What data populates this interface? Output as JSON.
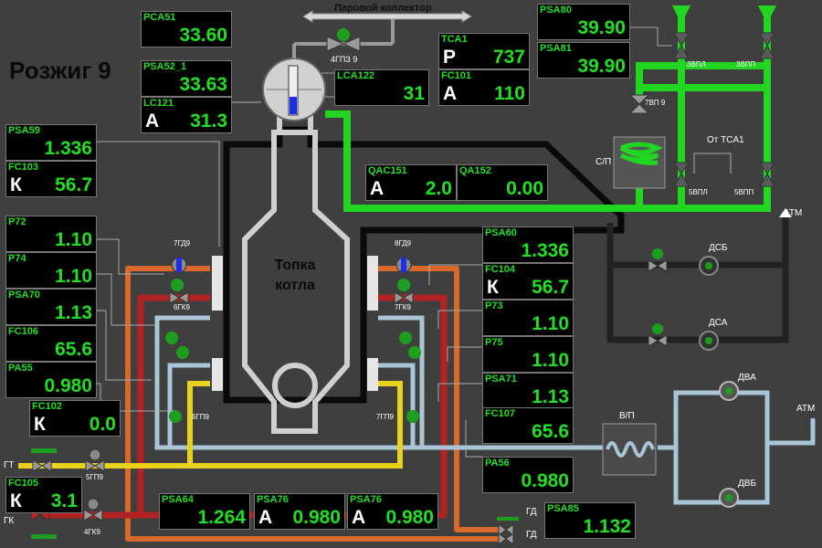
{
  "title": "Розжиг 9",
  "furnace_label": "Топка котла",
  "labels": {
    "steam_header": "Паровой коллектор",
    "from_tca1": "От TCA1",
    "atm1": "АТМ",
    "atm2": "АТМ",
    "dsb": "ДСБ",
    "dsa": "ДСА",
    "dva": "ДВА",
    "dvb": "ДВБ",
    "vp": "В/П",
    "sp": "С/П",
    "gt": "ГТ",
    "gk": "ГК",
    "gd1": "ГД",
    "gd2": "ГД"
  },
  "valves": {
    "v4gpz9": "4ГПЗ 9",
    "v3vpl": "3ВПЛ",
    "v3vpp": "3ВПП",
    "v7vp9": "7ВП 9",
    "v5vpl": "5ВПЛ",
    "v5vpp": "5ВПП",
    "v7gd9": "7ГД9",
    "v6gk9": "6ГК9",
    "v6gp9": "6ГП9",
    "v8gd9": "8ГД9",
    "v7gk9": "7ГК9",
    "v7gp9": "7ГП9",
    "v5gp9": "5ГП9",
    "v4gk9": "4ГК9"
  },
  "colors": {
    "steam_pipe": "#21d621",
    "gas_pipe": "#e8d21c",
    "fuel_pipe": "#b22222",
    "air_pipe": "#a9c6d8",
    "flue_pipe": "#222222",
    "value_text": "#21e021",
    "valve_indicator": "#1e9e1e"
  },
  "params": [
    {
      "tag": "PCA51",
      "value": "33.60"
    },
    {
      "tag": "PSA52_1",
      "value": "33.63"
    },
    {
      "tag": "LC121",
      "mode": "A",
      "value": "31.3"
    },
    {
      "tag": "TCA1",
      "mode": "P",
      "value": "737"
    },
    {
      "tag": "LCA122",
      "value": "31"
    },
    {
      "tag": "FC101",
      "mode": "A",
      "value": "110"
    },
    {
      "tag": "PSA80",
      "value": "39.90"
    },
    {
      "tag": "PSA81",
      "value": "39.90"
    },
    {
      "tag": "PSA59",
      "value": "1.336"
    },
    {
      "tag": "FC103",
      "mode": "К",
      "value": "56.7"
    },
    {
      "tag": "QAC151",
      "mode": "A",
      "value": "2.0"
    },
    {
      "tag": "QA152",
      "value": "0.00"
    },
    {
      "tag": "P72",
      "value": "1.10"
    },
    {
      "tag": "P74",
      "value": "1.10"
    },
    {
      "tag": "PSA70",
      "value": "1.13"
    },
    {
      "tag": "FC106",
      "value": "65.6"
    },
    {
      "tag": "PA55",
      "value": "0.980"
    },
    {
      "tag": "FC102",
      "mode": "К",
      "value": "0.0"
    },
    {
      "tag": "FC105",
      "mode": "К",
      "value": "3.1"
    },
    {
      "tag": "PSA64",
      "value": "1.264"
    },
    {
      "tag": "PSA76",
      "mode": "A",
      "value": "0.980"
    },
    {
      "tag": "PSA76",
      "mode": "A",
      "value": "0.980"
    },
    {
      "tag": "PSA60",
      "value": "1.336"
    },
    {
      "tag": "FC104",
      "mode": "К",
      "value": "56.7"
    },
    {
      "tag": "P73",
      "value": "1.10"
    },
    {
      "tag": "P75",
      "value": "1.10"
    },
    {
      "tag": "PSA71",
      "value": "1.13"
    },
    {
      "tag": "FC107",
      "value": "65.6"
    },
    {
      "tag": "PA56",
      "value": "0.980"
    },
    {
      "tag": "PSA85",
      "value": "1.132"
    }
  ]
}
